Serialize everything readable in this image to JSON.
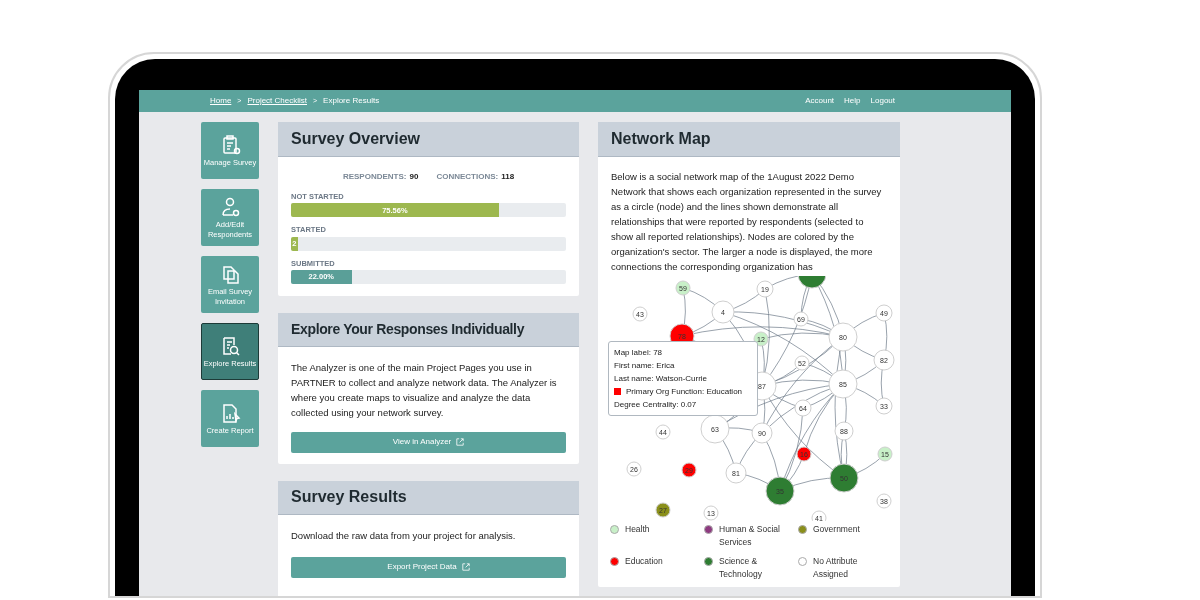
{
  "breadcrumb": [
    {
      "label": "Home",
      "link": true
    },
    {
      "label": "Project Checklist",
      "link": true
    },
    {
      "label": "Explore Results",
      "link": false
    }
  ],
  "breadcrumb_separator": ">",
  "top_links": [
    "Account",
    "Help",
    "Logout"
  ],
  "sidebar": [
    {
      "label": "Manage Survey",
      "selected": false
    },
    {
      "label": "Add/Edit Respondents",
      "selected": false
    },
    {
      "label": "Email Survey Invitation",
      "selected": false
    },
    {
      "label": "Explore Results",
      "selected": true
    },
    {
      "label": "Create Report",
      "selected": false
    }
  ],
  "survey_overview": {
    "title": "Survey Overview",
    "stats": [
      {
        "label": "RESPONDENTS:",
        "value": "90"
      },
      {
        "label": "CONNECTIONS:",
        "value": "118"
      }
    ],
    "bars": [
      {
        "label": "NOT STARTED",
        "level": 0.7556,
        "reading": "75.56%",
        "color": "#9db84f"
      },
      {
        "label": "STARTED",
        "level": 0.0222,
        "reading": "2",
        "color": "#9db84f"
      },
      {
        "label": "SUBMITTED",
        "level": 0.22,
        "reading": "22.00%",
        "color": "#5a9f98"
      }
    ]
  },
  "explore": {
    "title": "Explore Your Responses Individually",
    "text": "The Analyzer is one of the main Project Pages you use in PARTNER to collect and analyze network data. The Analyzer is where you create maps to visualize and analyze the data collected using your network survey.",
    "button": "View in Analyzer"
  },
  "results": {
    "title": "Survey Results",
    "text": "Download the raw data from your project for analysis.",
    "button": "Export Project Data"
  },
  "network_map": {
    "title": "Network Map",
    "text": "Below is a social network map of the 1August 2022 Demo Network that shows each organization represented in the survey as a circle (node) and the lines shown demonstrate all relationships that were reported by respondents (selected to show all reported relationships). Nodes are colored by the organization's sector. The larger a node is displayed, the more connections the corresponding organization has",
    "nodes": [
      {
        "label": "59",
        "color": "#c8f0c8"
      },
      {
        "label": "19",
        "color": "#ffffff"
      },
      {
        "color": "#2e7d32"
      },
      {
        "label": "43",
        "color": "#ffffff"
      },
      {
        "label": "4",
        "color": "#ffffff"
      },
      {
        "label": "78",
        "color": "#ff0000"
      },
      {
        "label": "12",
        "color": "#c8f0c8"
      },
      {
        "label": "69",
        "color": "#ffffff"
      },
      {
        "label": "80",
        "color": "#ffffff"
      },
      {
        "label": "49",
        "color": "#ffffff"
      },
      {
        "label": "52",
        "color": "#ffffff"
      },
      {
        "label": "82",
        "color": "#ffffff"
      },
      {
        "label": "87",
        "color": "#ffffff"
      },
      {
        "label": "85",
        "color": "#ffffff"
      },
      {
        "label": "64",
        "color": "#ffffff"
      },
      {
        "label": "33",
        "color": "#ffffff"
      },
      {
        "label": "44",
        "color": "#ffffff"
      },
      {
        "label": "63",
        "color": "#ffffff"
      },
      {
        "label": "90",
        "color": "#ffffff"
      },
      {
        "label": "88",
        "color": "#ffffff"
      },
      {
        "label": "16",
        "color": "#ff0000"
      },
      {
        "label": "15",
        "color": "#c8f0c8"
      },
      {
        "label": "26",
        "color": "#ffffff"
      },
      {
        "label": "29",
        "color": "#ff0000"
      },
      {
        "label": "81",
        "color": "#ffffff"
      },
      {
        "label": "35",
        "color": "#2e7d32"
      },
      {
        "label": "50",
        "color": "#2e7d32"
      },
      {
        "label": "38",
        "color": "#ffffff"
      },
      {
        "label": "27",
        "color": "#8a8f1a"
      },
      {
        "label": "13",
        "color": "#ffffff"
      },
      {
        "label": "41",
        "color": "#ffffff"
      }
    ],
    "tooltip": [
      {
        "text": "Map label: 78"
      },
      {
        "text": "First name: Erica"
      },
      {
        "text": "Last name: Watson-Currie"
      },
      {
        "text": "Primary Org Function: Education",
        "color": "#ff0000"
      },
      {
        "text": "Degree Centrality: 0.07"
      }
    ],
    "legend": [
      {
        "label": "Health",
        "color": "#c8f0c8"
      },
      {
        "label": "Human & Social Services",
        "color": "#8e3a80"
      },
      {
        "label": "Government",
        "color": "#8a8f1a"
      },
      {
        "label": "Education",
        "color": "#ff0000"
      },
      {
        "label": "Science & Technology",
        "color": "#2e7d32"
      },
      {
        "label": "No Attribute Assigned",
        "color": "#ffffff"
      }
    ]
  }
}
